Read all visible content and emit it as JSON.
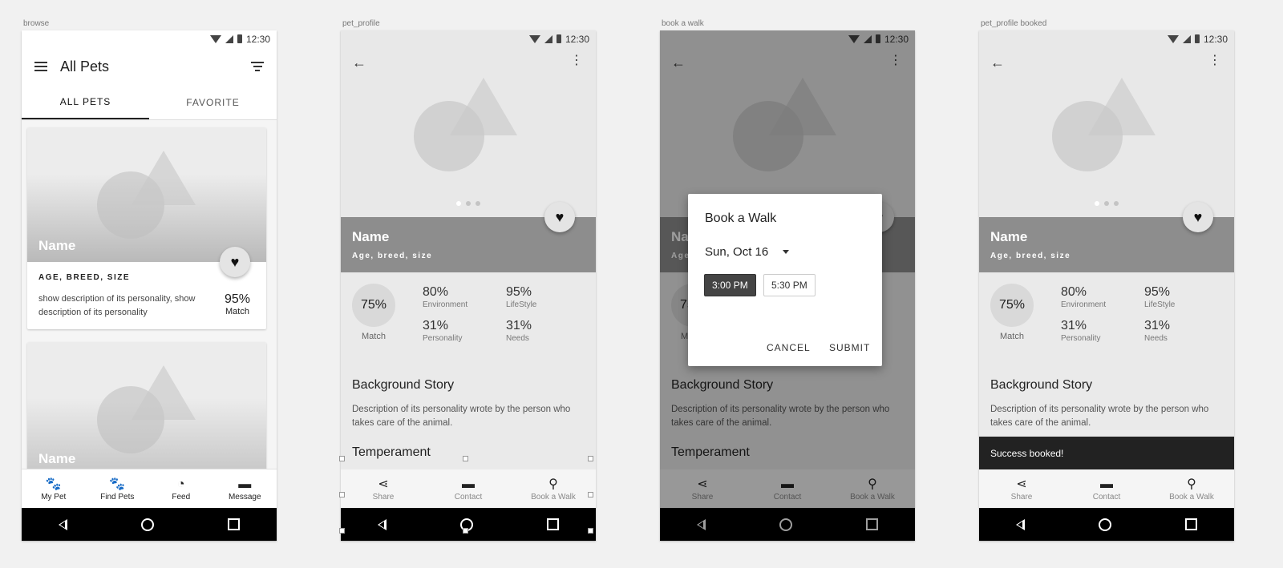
{
  "labels": [
    "browse",
    "pet_profile",
    "book a walk",
    "pet_profile booked"
  ],
  "status_time": "12:30",
  "browse": {
    "title": "All Pets",
    "tabs": [
      {
        "label": "ALL PETS"
      },
      {
        "label": "FAVORITE"
      }
    ],
    "cards": [
      {
        "name": "Name",
        "meta": "AGE, BREED, SIZE",
        "desc": "show description of its personality, show description of its personality",
        "pct": "95%",
        "pct_label": "Match"
      },
      {
        "name": "Name"
      }
    ],
    "bottom_nav": [
      {
        "label": "My Pet",
        "icon": "pets-family-icon"
      },
      {
        "label": "Find Pets",
        "icon": "paw-icon"
      },
      {
        "label": "Feed",
        "icon": "rss-icon"
      },
      {
        "label": "Message",
        "icon": "message-icon"
      }
    ]
  },
  "profile": {
    "name": "Name",
    "subtitle": "Age, breed, size",
    "match_pct": "75%",
    "match_label": "Match",
    "stats": [
      {
        "value": "80%",
        "label": "Environment"
      },
      {
        "value": "95%",
        "label": "LifeStyle"
      },
      {
        "value": "31%",
        "label": "Personality"
      },
      {
        "value": "31%",
        "label": "Needs"
      }
    ],
    "story_title": "Background Story",
    "story_text": "Description of its personality wrote by the person who takes care of the animal.",
    "temperament_title": "Temperament",
    "actions": [
      {
        "label": "Share",
        "icon": "share-icon"
      },
      {
        "label": "Contact",
        "icon": "chat-icon"
      },
      {
        "label": "Book a Walk",
        "icon": "walk-icon"
      }
    ]
  },
  "dialog": {
    "title": "Book a Walk",
    "date": "Sun, Oct 16",
    "times": [
      {
        "label": "3:00 PM",
        "selected": true
      },
      {
        "label": "5:30 PM",
        "selected": false
      }
    ],
    "cancel": "CANCEL",
    "submit": "SUBMIT"
  },
  "snackbar": "Success booked!"
}
